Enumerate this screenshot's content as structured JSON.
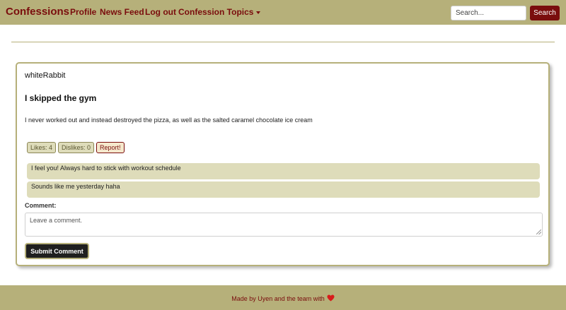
{
  "navbar": {
    "brand": "Confessions",
    "links": [
      "Profile",
      "News Feed",
      "Log out"
    ],
    "dropdown_label": "Confession Topics",
    "search_placeholder": "Search...",
    "search_button": "Search"
  },
  "post": {
    "username": "whiteRabbit",
    "title": "I skipped the gym",
    "body": "I never worked out and instead destroyed the pizza, as well as the salted caramel chocolate ice cream",
    "likes": "Likes: 4",
    "dislikes": "Dislikes: 0",
    "report": "Report!",
    "comments": [
      "I feel you! Always hard to stick with workout schedule",
      "Sounds like me yesterday haha"
    ],
    "comment_label": "Comment:",
    "comment_placeholder": "Leave a comment.",
    "submit_label": "Submit Comment"
  },
  "footer": {
    "text": "Made by Uyen and the team with",
    "icon": "heart-icon"
  },
  "colors": {
    "brand_olive": "#b6b07a",
    "accent_maroon": "#7a0d0d",
    "comment_bg": "#dedcba",
    "submit_bg": "#1f1f1f",
    "heart": "#d81b1b"
  }
}
